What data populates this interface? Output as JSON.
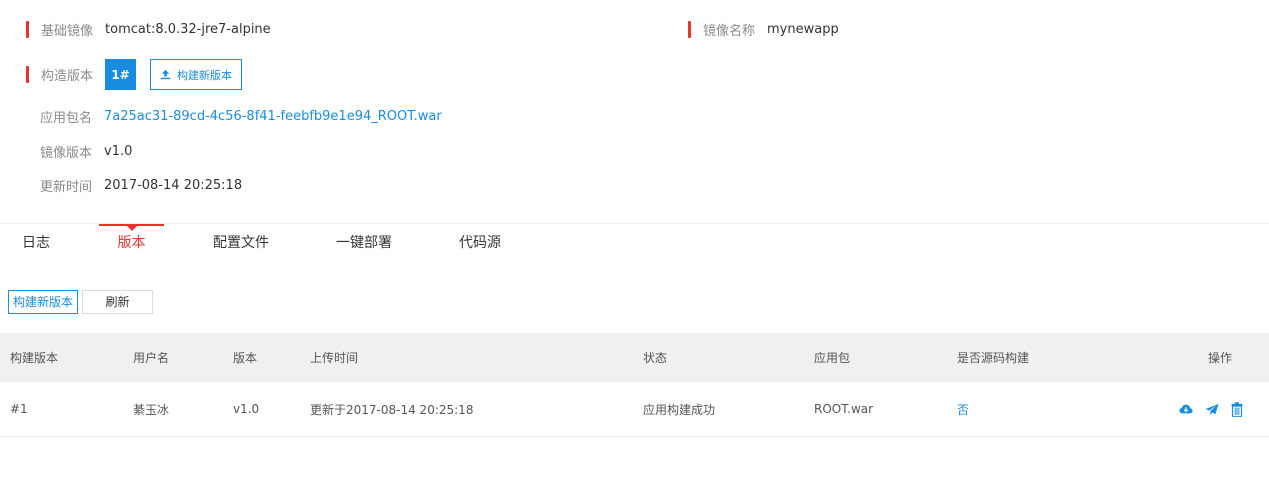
{
  "info": {
    "base_image_label": "基础镜像",
    "base_image_value": "tomcat:8.0.32-jre7-alpine",
    "image_name_label": "镜像名称",
    "image_name_value": "mynewapp",
    "build_version_label": "构造版本",
    "build_version_badge": "1#",
    "build_new_version_button": "构建新版本",
    "package_label": "应用包名",
    "package_value": "7a25ac31-89cd-4c56-8f41-feebfb9e1e94_ROOT.war",
    "image_version_label": "镜像版本",
    "image_version_value": "v1.0",
    "update_time_label": "更新时间",
    "update_time_value": "2017-08-14 20:25:18"
  },
  "tabs": [
    {
      "label": "日志",
      "active": false
    },
    {
      "label": "版本",
      "active": true
    },
    {
      "label": "配置文件",
      "active": false
    },
    {
      "label": "一键部署",
      "active": false
    },
    {
      "label": "代码源",
      "active": false
    }
  ],
  "actions": {
    "build_new": "构建新版本",
    "refresh": "刷新"
  },
  "table": {
    "headers": [
      "构建版本",
      "用户名",
      "版本",
      "上传时间",
      "状态",
      "应用包",
      "是否源码构建",
      "操作"
    ],
    "rows": [
      {
        "build": "#1",
        "user": "綦玉冰",
        "version": "v1.0",
        "upload_time": "更新于2017-08-14 20:25:18",
        "status": "应用构建成功",
        "package": "ROOT.war",
        "source_build": "否"
      }
    ]
  },
  "icons": {
    "upload": "upload-icon",
    "download": "cloud-download-icon",
    "deploy": "send-icon",
    "delete": "trash-icon"
  },
  "colors": {
    "accent_blue": "#1a8ce0",
    "accent_red": "#e8332d"
  }
}
